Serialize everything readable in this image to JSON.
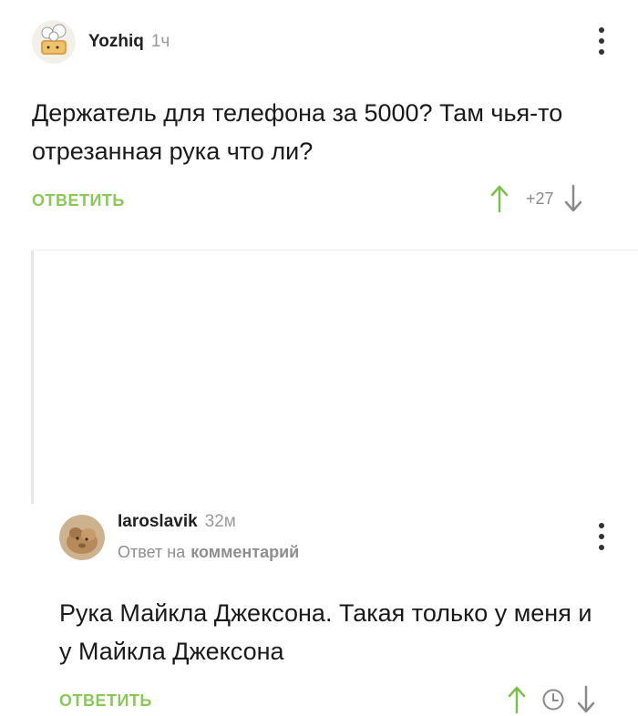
{
  "comments": [
    {
      "username": "Yozhiq",
      "time": "1ч",
      "text": "Держатель для телефона за 5000? Там чья-то отрезанная рука что ли?",
      "reply_label": "ОТВЕТИТЬ",
      "score": "+27"
    },
    {
      "username": "Iaroslavik",
      "time": "32м",
      "reply_to_prefix": "Ответ на",
      "reply_to_target": "комментарий",
      "text": "Рука Майкла Джексона. Такая только у меня и у Майкла Джексона",
      "reply_label": "ОТВЕТИТЬ"
    }
  ],
  "colors": {
    "accent": "#8ac858",
    "arrow_up": "#7cbf4a",
    "muted": "#9a9a9a"
  },
  "icons": [
    "avatar-sticker",
    "avatar-animal",
    "more-vertical-icon",
    "arrow-up-icon",
    "arrow-down-icon",
    "clock-icon"
  ]
}
